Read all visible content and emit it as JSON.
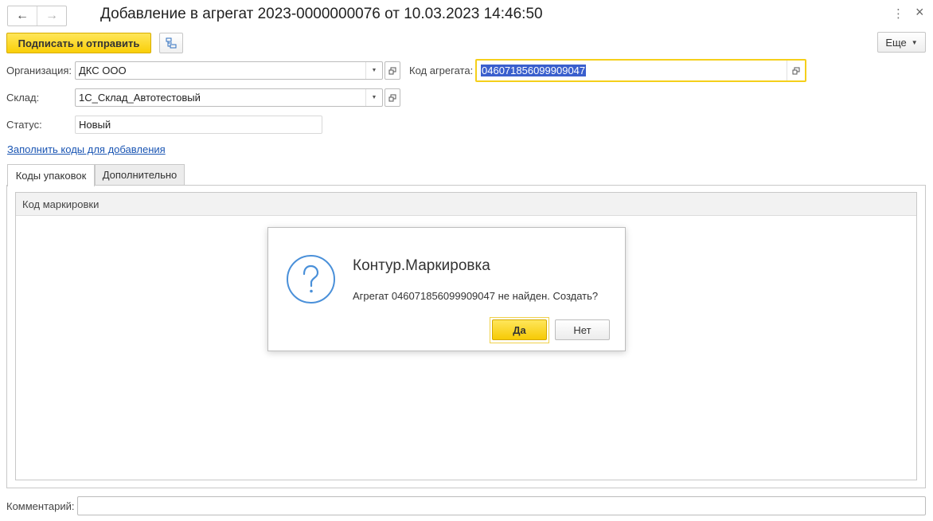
{
  "window": {
    "title": "Добавление в агрегат 2023-0000000076 от 10.03.2023 14:46:50",
    "back_icon": "←",
    "forward_icon": "→",
    "menu_icon": "⋮",
    "close_icon": "×"
  },
  "toolbar": {
    "sign_send_label": "Подписать и отправить",
    "more_label": "Еще"
  },
  "form": {
    "organization": {
      "label": "Организация:",
      "value": "ДКС ООО"
    },
    "warehouse": {
      "label": "Склад:",
      "value": "1С_Склад_Автотестовый"
    },
    "status": {
      "label": "Статус:",
      "value": "Новый"
    },
    "aggregate_code": {
      "label": "Код агрегата:",
      "value": "046071856099909047"
    },
    "fill_codes_link": "Заполнить коды для добавления",
    "comment": {
      "label": "Комментарий:",
      "value": ""
    }
  },
  "tabs": [
    {
      "label": "Коды упаковок",
      "active": true
    },
    {
      "label": "Дополнительно",
      "active": false
    }
  ],
  "table": {
    "columns": [
      "Код маркировки"
    ],
    "rows": []
  },
  "dialog": {
    "title": "Контур.Маркировка",
    "message": "Агрегат 046071856099909047 не найден. Создать?",
    "yes_label": "Да",
    "no_label": "Нет",
    "icon": "question-icon"
  },
  "colors": {
    "accent_yellow": "#f9cf08",
    "link_blue": "#1a55b3",
    "selection_blue": "#3a5fcd",
    "dialog_icon_blue": "#4a90d9"
  }
}
